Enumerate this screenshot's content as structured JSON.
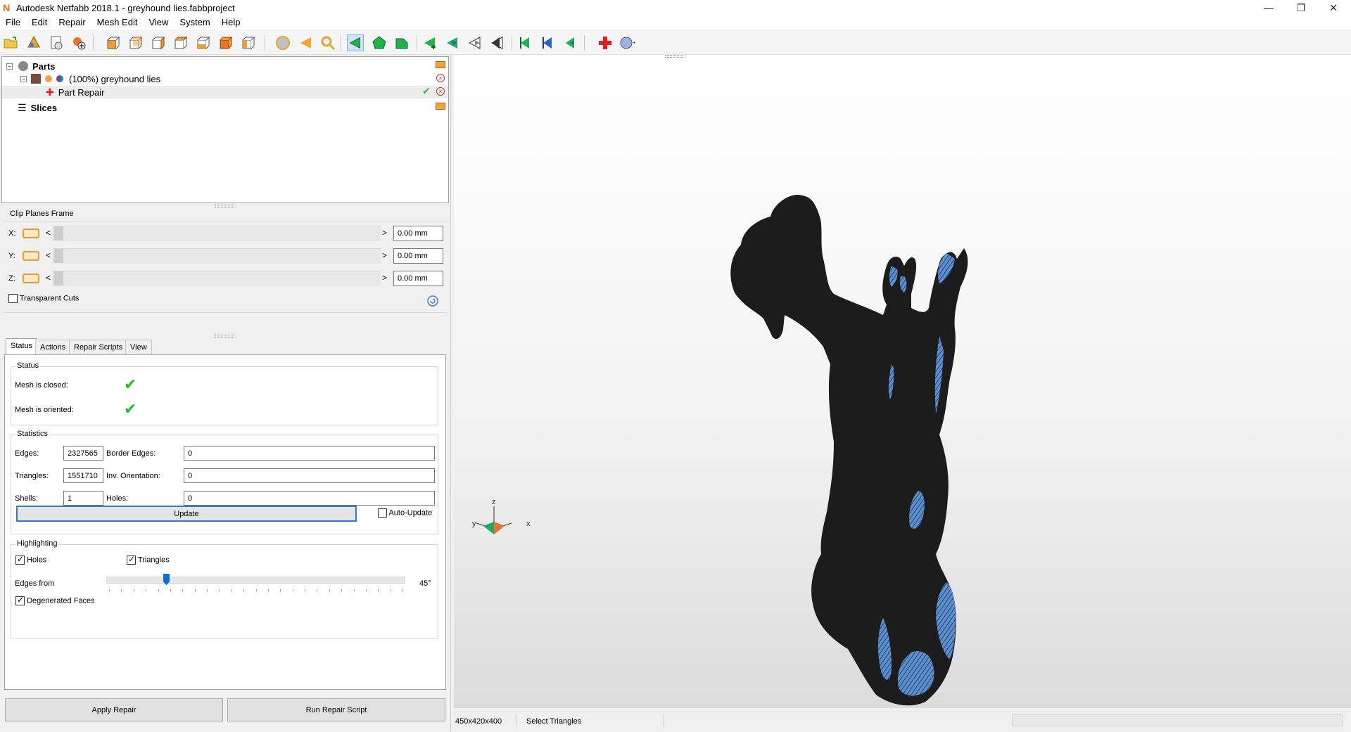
{
  "window": {
    "title": "Autodesk Netfabb 2018.1 - greyhound lies.fabbproject",
    "logo_letter": "N",
    "minimize": "—",
    "maximize": "❐",
    "close": "✕"
  },
  "menu": [
    "File",
    "Edit",
    "Repair",
    "Mesh Edit",
    "View",
    "System",
    "Help"
  ],
  "tree": {
    "parts_label": "Parts",
    "part_name": "(100%) greyhound lies",
    "repair_label": "Part Repair",
    "slices_label": "Slices"
  },
  "clip_planes": {
    "title": "Clip Planes Frame",
    "rows": [
      {
        "axis": "X:",
        "value": "0.00 mm"
      },
      {
        "axis": "Y:",
        "value": "0.00 mm"
      },
      {
        "axis": "Z:",
        "value": "0.00 mm"
      }
    ],
    "transparent_cuts": "Transparent Cuts",
    "transparent_cuts_checked": false
  },
  "tabs": [
    "Status",
    "Actions",
    "Repair Scripts",
    "View"
  ],
  "active_tab": "Status",
  "status": {
    "title": "Status",
    "mesh_closed": "Mesh is closed:",
    "mesh_oriented": "Mesh is oriented:"
  },
  "statistics": {
    "title": "Statistics",
    "edges_label": "Edges:",
    "edges": "2327565",
    "border_edges_label": "Border Edges:",
    "border_edges": "0",
    "triangles_label": "Triangles:",
    "triangles": "1551710",
    "inv_orientation_label": "Inv. Orientation:",
    "inv_orientation": "0",
    "shells_label": "Shells:",
    "shells": "1",
    "holes_label": "Holes:",
    "holes": "0",
    "update_button": "Update",
    "auto_update": "Auto-Update",
    "auto_update_checked": false
  },
  "highlighting": {
    "title": "Highlighting",
    "holes": "Holes",
    "holes_checked": true,
    "triangles": "Triangles",
    "triangles_checked": true,
    "edges_from": "Edges from",
    "edges_angle": "45°",
    "edges_slider_fraction": 0.2,
    "degenerated_faces": "Degenerated Faces",
    "degenerated_checked": true
  },
  "buttons": {
    "apply_repair": "Apply Repair",
    "run_repair_script": "Run Repair Script"
  },
  "axes_gizmo": {
    "x": "x",
    "y": "y",
    "z": "z"
  },
  "statusbar": {
    "dimensions": "450x420x400",
    "mode": "Select Triangles"
  },
  "colors": {
    "mesh": "#1c1c1c",
    "highlight": "#5b8fd0",
    "accent": "#2d7bd3",
    "ok_check": "#2eb82e"
  }
}
